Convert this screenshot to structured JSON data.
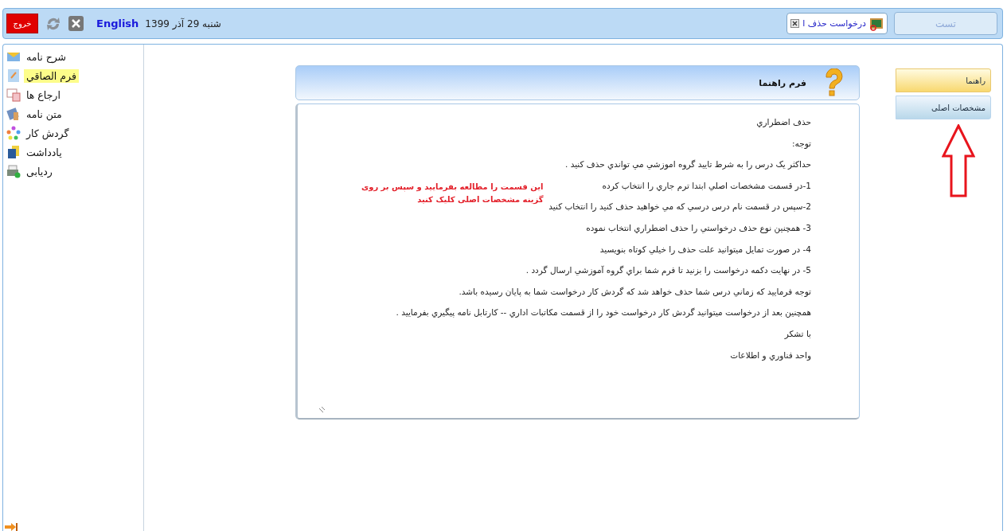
{
  "top_bar": {
    "exit_button": "خروج",
    "language_link": "English",
    "date": "شنبه 29 آذر 1399",
    "tabs": [
      {
        "label": "درخواست حذف ا",
        "selected": true
      }
    ],
    "user_box": "تست"
  },
  "sidebar": {
    "items": [
      {
        "label": "شرح نامه",
        "selected": false,
        "kind": "envelope"
      },
      {
        "label": "فرم الصاقي",
        "selected": true,
        "kind": "attach"
      },
      {
        "label": "ارجاع ها",
        "selected": false,
        "kind": "refer"
      },
      {
        "label": "متن نامه",
        "selected": false,
        "kind": "text"
      },
      {
        "label": "گردش کار",
        "selected": false,
        "kind": "flow"
      },
      {
        "label": "يادداشت",
        "selected": false,
        "kind": "note"
      },
      {
        "label": "ردیابی",
        "selected": false,
        "kind": "track"
      }
    ]
  },
  "help_card": {
    "title": "فرم راهنما",
    "lines": [
      "حذف اضطراري",
      "توجه:",
      "حداكثر يک درس را به شرط تاييد گروه اموزشي مي تواندي حذف كنيد .",
      "1-در قسمت مشخصات اصلي ابتدا ترم جاري را انتخاب كرده",
      "2-سپس در قسمت نام درس درسي كه مي خواهيد حذف كنيد را انتخاب كنيد",
      "3- همچنين نوع حذف درخواستي را حذف اضطراري انتخاب نموده",
      "4-  در صورت تمايل ميتوانيد علت حذف را خيلي كوتاه بنويسيد",
      "5- در نهايت دكمه درخواست را بزنيد تا فرم شما براي گروه آموزشي ارسال گردد .",
      "توجه فرماييد كه زماني درس شما حذف خواهد شد كه گردش كار درخواست شما به پايان رسيده باشد.",
      "همچنين بعد از درخواست ميتوانيد گردش كار درخواست خود را از قسمت مكاتبات اداري -- كارتابل نامه پيگيري بفرماييد .",
      "با تشکر",
      "واحد فناوري و اطلاعات"
    ],
    "note": [
      "این قسمت را مطالعه بفرمایید و سپس بر روی",
      "گزینه مشخصات اصلی کلیک کنید"
    ]
  },
  "side_tabs": [
    {
      "label": "راهنما",
      "selected": true
    },
    {
      "label": "مشخصات اصلی",
      "selected": false
    }
  ]
}
